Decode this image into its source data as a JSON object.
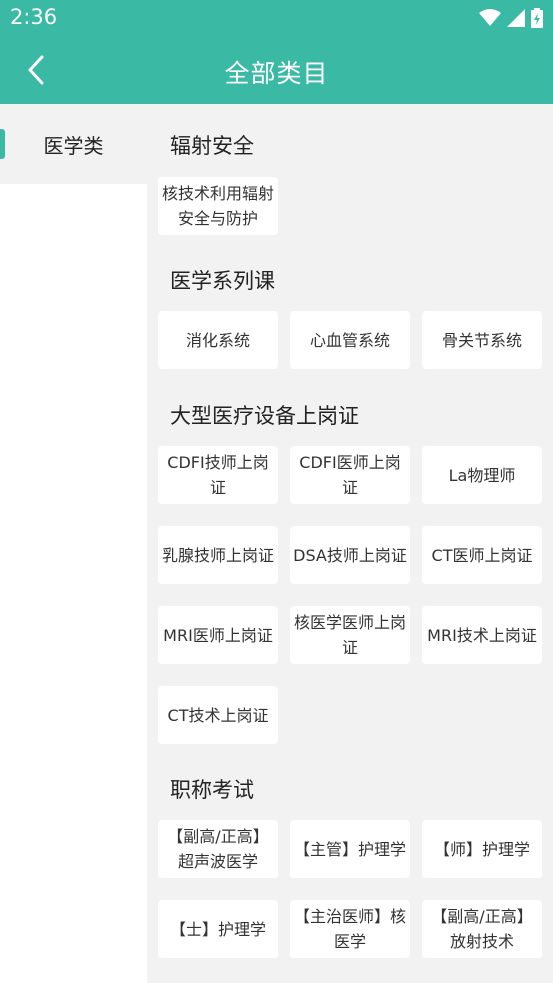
{
  "status_bar": {
    "time": "2:36"
  },
  "header": {
    "title": "全部类目"
  },
  "sidebar": {
    "items": [
      {
        "label": "医学类",
        "active": true
      }
    ]
  },
  "sections": [
    {
      "title": "辐射安全",
      "items": [
        "核技术利用辐射\n安全与防护"
      ]
    },
    {
      "title": "医学系列课",
      "items": [
        "消化系统",
        "心血管系统",
        "骨关节系统"
      ]
    },
    {
      "title": "大型医疗设备上岗证",
      "items": [
        "CDFI技师上岗\n证",
        "CDFI医师上岗\n证",
        "La物理师",
        "乳腺技师上岗证",
        "DSA技师上岗证",
        "CT医师上岗证",
        "MRI医师上岗证",
        "核医学医师上岗\n证",
        "MRI技术上岗证",
        "CT技术上岗证"
      ]
    },
    {
      "title": "职称考试",
      "items": [
        "【副高/正高】\n超声波医学",
        "【主管】护理学",
        "【师】护理学",
        "【士】护理学",
        "【主治医师】核\n医学",
        "【副高/正高】\n放射技术"
      ]
    }
  ],
  "colors": {
    "accent": "#3ab9a5",
    "background": "#f2f2f2"
  }
}
